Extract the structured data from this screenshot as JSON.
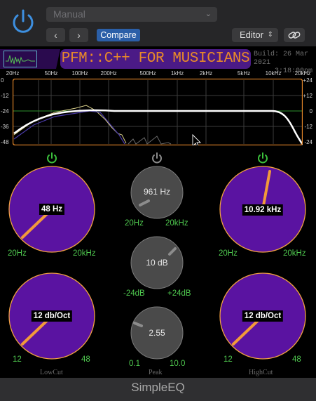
{
  "host": {
    "preset": "Manual",
    "compare_label": "Compare",
    "editor_label": "Editor",
    "prev_glyph": "‹",
    "next_glyph": "›"
  },
  "plugin": {
    "title": "PFM::C++ FOR MUSICIANS",
    "build_line1": "Build: 26 Mar 2021",
    "build_line2": "3:18:00pm",
    "freq_labels": [
      "20Hz",
      "50Hz",
      "100Hz",
      "200Hz",
      "500Hz",
      "1kHz",
      "2kHz",
      "5kHz",
      "10kHz",
      "20kHz"
    ],
    "db_left": [
      "0",
      "-12",
      "-24",
      "-36",
      "-48"
    ],
    "db_right": [
      "+24",
      "+12",
      "0",
      "-12",
      "-24"
    ],
    "footer": "SimpleEQ"
  },
  "lowcut": {
    "freq_value": "48 Hz",
    "freq_min": "20Hz",
    "freq_max": "20kHz",
    "slope_value": "12 db/Oct",
    "slope_min": "12",
    "slope_max": "48",
    "label": "LowCut",
    "bypass_color": "#3bbf3b"
  },
  "peak": {
    "freq_value": "961 Hz",
    "freq_min": "20Hz",
    "freq_max": "20kHz",
    "gain_value": "10 dB",
    "gain_min": "-24dB",
    "gain_max": "+24dB",
    "q_value": "2.55",
    "q_min": "0.1",
    "q_max": "10.0",
    "label": "Peak",
    "bypass_color": "#8a8a8a"
  },
  "highcut": {
    "freq_value": "10.92 kHz",
    "freq_min": "20Hz",
    "freq_max": "20kHz",
    "slope_value": "12 db/Oct",
    "slope_min": "12",
    "slope_max": "48",
    "label": "HighCut",
    "bypass_color": "#3bbf3b"
  },
  "colors": {
    "purple_knob": "#5a13a1",
    "knob_ring": "#f0a040",
    "knob_pointer": "#f29a3a",
    "range_text": "#4fc94f",
    "response_curve": "#ffffff",
    "grid": "#3c3c3c",
    "graph_border": "#e8892a"
  }
}
